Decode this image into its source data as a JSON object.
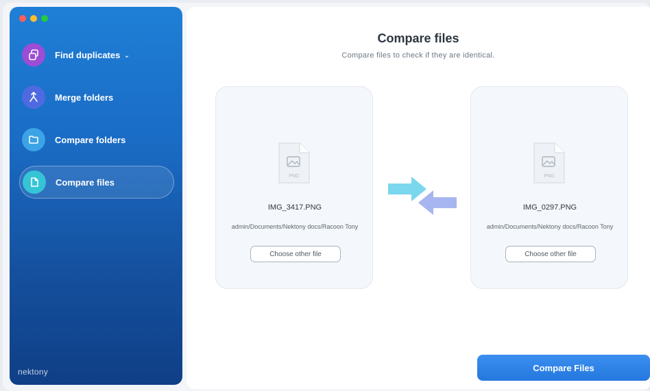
{
  "sidebar": {
    "items": [
      {
        "label": "Find duplicates",
        "chevron": "⌄",
        "icon": "duplicates-icon",
        "icon_color": "#9b4dd6"
      },
      {
        "label": "Merge folders",
        "icon": "merge-icon",
        "icon_color": "#4f6ae0"
      },
      {
        "label": "Compare folders",
        "icon": "folder-icon",
        "icon_color": "#3ba3e6"
      },
      {
        "label": "Compare files",
        "icon": "file-icon",
        "icon_color": "#35c4d6",
        "active": true
      }
    ],
    "brand": "nektony"
  },
  "main": {
    "title": "Compare files",
    "subtitle": "Compare files to check if they are identical.",
    "left_file": {
      "name": "IMG_3417.PNG",
      "path": "admin/Documents/Nektony docs/Racoon Tony",
      "type_label": "PNG",
      "button": "Choose other file"
    },
    "right_file": {
      "name": "IMG_0297.PNG",
      "path": "admin/Documents/Nektony docs/Racoon Tony",
      "type_label": "PNG",
      "button": "Choose other file"
    },
    "compare_button": "Compare Files"
  },
  "colors": {
    "accent": "#2a7fe3",
    "sidebar_top": "#1f7fd6",
    "sidebar_bottom": "#0f3f86"
  }
}
